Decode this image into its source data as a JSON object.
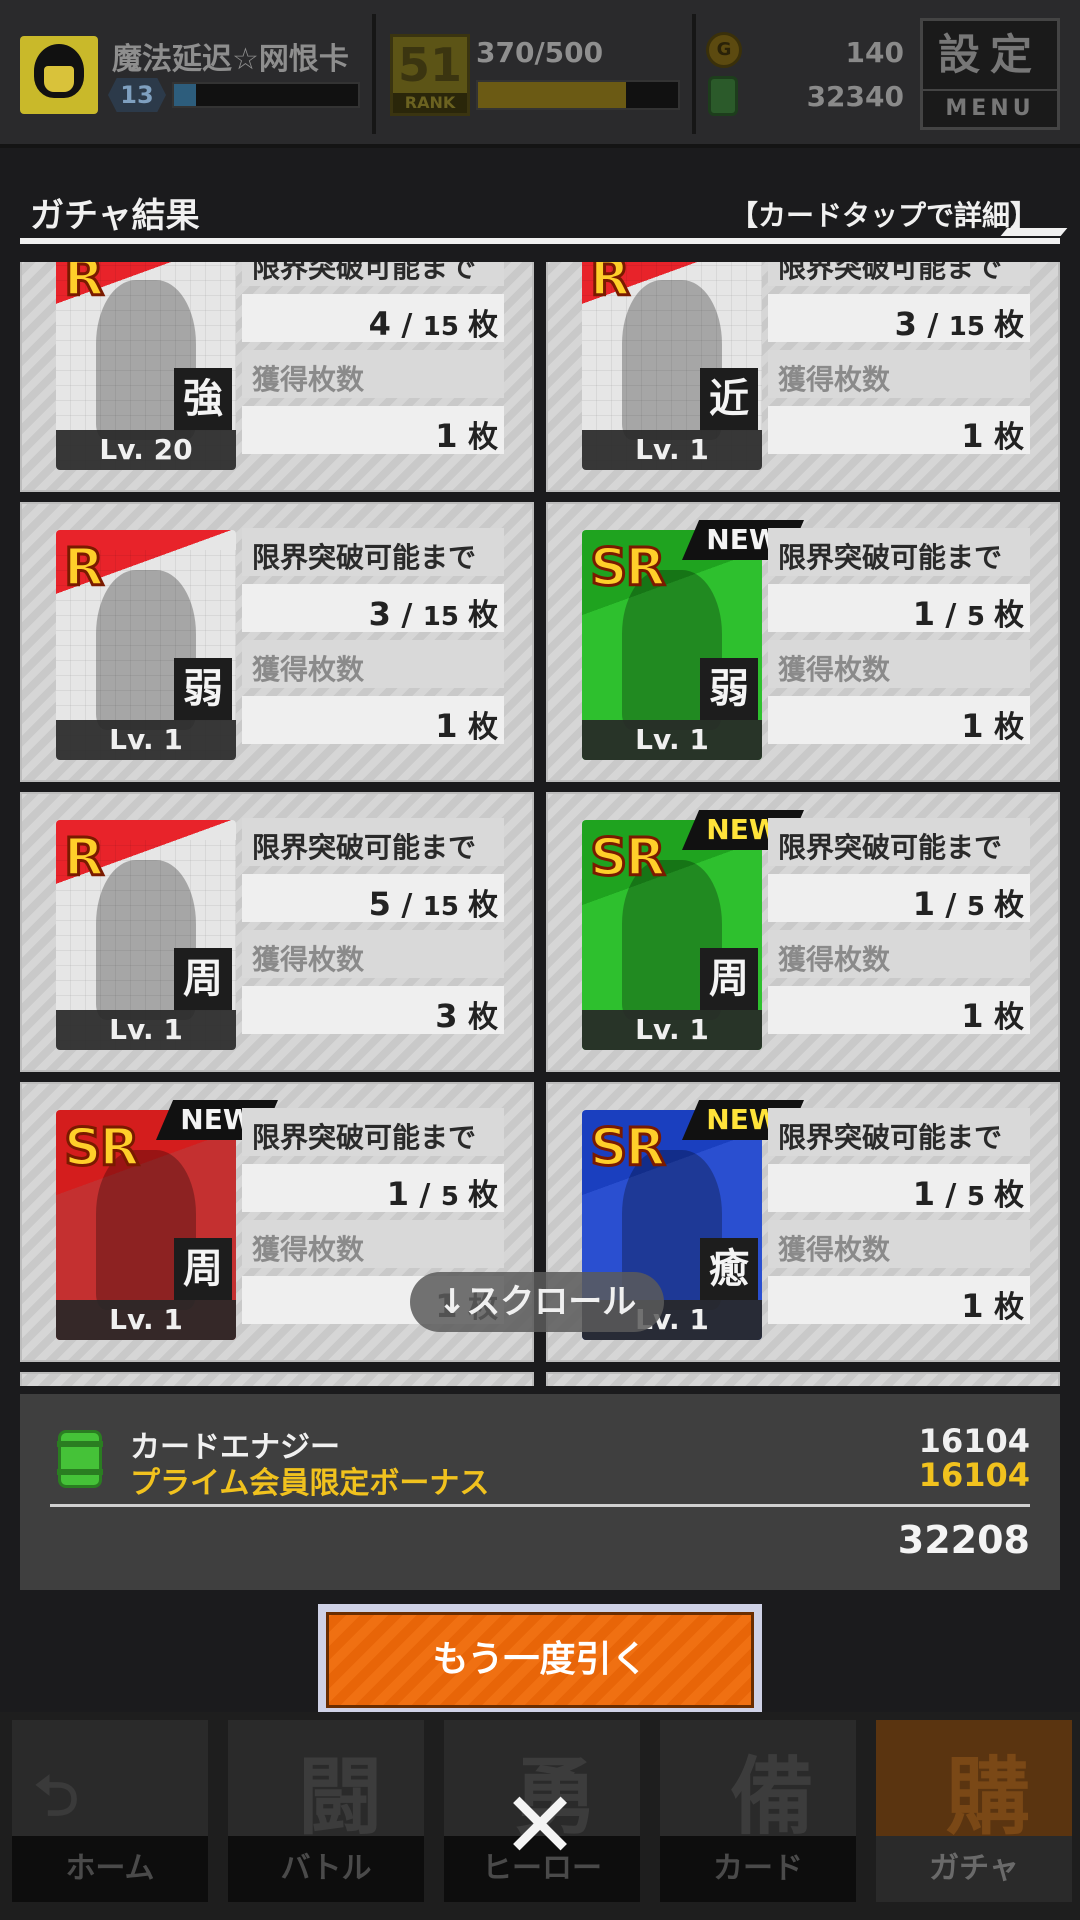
{
  "header": {
    "player_name": "魔法延迟☆网恨卡",
    "player_level": "13",
    "exp_fraction": 0.12,
    "rank_number": "51",
    "rank_label": "RANK",
    "stamina": "370/500",
    "stamina_fraction": 0.74,
    "coin_icon": "coin-icon",
    "coins": "140",
    "energy": "32340",
    "menu_kanji": "設定",
    "menu_label": "MENU"
  },
  "result": {
    "title": "ガチャ結果",
    "hint": "【カードタップで詳細】"
  },
  "labels": {
    "limit_break": "限界突破可能まで",
    "obtained": "獲得枚数",
    "unit": "枚",
    "new": "NEW"
  },
  "cards": [
    {
      "rarity": "R",
      "type": "強",
      "level": "Lv. 20",
      "limit_cur": "4",
      "limit_max": "15",
      "obtained": "1",
      "new": false
    },
    {
      "rarity": "R",
      "type": "近",
      "level": "Lv. 1",
      "limit_cur": "3",
      "limit_max": "15",
      "obtained": "1",
      "new": false
    },
    {
      "rarity": "R",
      "type": "弱",
      "level": "Lv. 1",
      "limit_cur": "3",
      "limit_max": "15",
      "obtained": "1",
      "new": false
    },
    {
      "rarity": "SR",
      "type": "弱",
      "level": "Lv. 1",
      "limit_cur": "1",
      "limit_max": "5",
      "obtained": "1",
      "new": true
    },
    {
      "rarity": "R",
      "type": "周",
      "level": "Lv. 1",
      "limit_cur": "5",
      "limit_max": "15",
      "obtained": "3",
      "new": false
    },
    {
      "rarity": "SR",
      "type": "周",
      "level": "Lv. 1",
      "limit_cur": "1",
      "limit_max": "5",
      "obtained": "1",
      "new": true
    },
    {
      "rarity": "SR",
      "type": "周",
      "level": "Lv. 1",
      "limit_cur": "1",
      "limit_max": "5",
      "obtained": "1",
      "new": true
    },
    {
      "rarity": "SR",
      "type": "癒",
      "level": "Lv. 1",
      "limit_cur": "1",
      "limit_max": "5",
      "obtained": "1",
      "new": true
    }
  ],
  "scroll_hint": "↓スクロール",
  "energy_panel": {
    "energy_label": "カードエナジー",
    "energy_amount": "16104",
    "bonus_label": "プライム会員限定ボーナス",
    "bonus_amount": "16104",
    "total": "32208"
  },
  "draw_again_label": "もう一度引く",
  "nav": [
    {
      "label": "ホーム",
      "glyph": "",
      "mini": "⮌",
      "icon": "home-icon"
    },
    {
      "label": "バトル",
      "glyph": "闘",
      "mini": "",
      "icon": "gamepad-icon"
    },
    {
      "label": "ヒーロー",
      "glyph": "勇",
      "mini": "",
      "icon": "hero-icon"
    },
    {
      "label": "カード",
      "glyph": "備",
      "mini": "",
      "icon": "card-icon"
    },
    {
      "label": "ガチャ",
      "glyph": "購",
      "mini": "",
      "icon": "gacha-icon"
    }
  ],
  "close_symbol": "✕",
  "colors": {
    "accent_orange": "#f07012",
    "bonus_gold": "#f1c21e",
    "rarity_r_red": "#e8232a",
    "sr_green": "#1fa31f",
    "sr_blue": "#1a3fbf"
  }
}
